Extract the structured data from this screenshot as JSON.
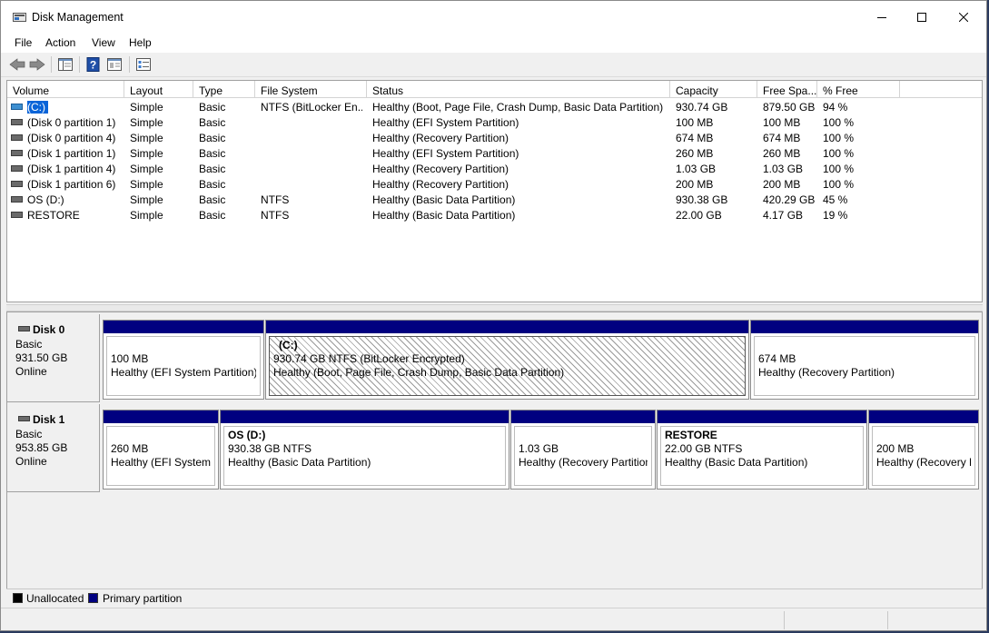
{
  "window": {
    "title": "Disk Management",
    "controls": {
      "minimize": "minimize",
      "maximize": "maximize",
      "close": "close"
    }
  },
  "menubar": {
    "items": [
      "File",
      "Action",
      "View",
      "Help"
    ]
  },
  "toolbar": {
    "buttons": [
      "back-icon",
      "forward-icon",
      "console-tree-icon",
      "help-icon",
      "properties-icon",
      "settings-icon"
    ]
  },
  "volume_list": {
    "columns": [
      "Volume",
      "Layout",
      "Type",
      "File System",
      "Status",
      "Capacity",
      "Free Spa...",
      "% Free"
    ],
    "rows": [
      {
        "volume": "(C:)",
        "layout": "Simple",
        "type": "Basic",
        "fs": "NTFS (BitLocker En...",
        "status": "Healthy (Boot, Page File, Crash Dump, Basic Data Partition)",
        "capacity": "930.74 GB",
        "free": "879.50 GB",
        "pct": "94 %",
        "selected": true
      },
      {
        "volume": "(Disk 0 partition 1)",
        "layout": "Simple",
        "type": "Basic",
        "fs": "",
        "status": "Healthy (EFI System Partition)",
        "capacity": "100 MB",
        "free": "100 MB",
        "pct": "100 %"
      },
      {
        "volume": "(Disk 0 partition 4)",
        "layout": "Simple",
        "type": "Basic",
        "fs": "",
        "status": "Healthy (Recovery Partition)",
        "capacity": "674 MB",
        "free": "674 MB",
        "pct": "100 %"
      },
      {
        "volume": "(Disk 1 partition 1)",
        "layout": "Simple",
        "type": "Basic",
        "fs": "",
        "status": "Healthy (EFI System Partition)",
        "capacity": "260 MB",
        "free": "260 MB",
        "pct": "100 %"
      },
      {
        "volume": "(Disk 1 partition 4)",
        "layout": "Simple",
        "type": "Basic",
        "fs": "",
        "status": "Healthy (Recovery Partition)",
        "capacity": "1.03 GB",
        "free": "1.03 GB",
        "pct": "100 %"
      },
      {
        "volume": "(Disk 1 partition 6)",
        "layout": "Simple",
        "type": "Basic",
        "fs": "",
        "status": "Healthy (Recovery Partition)",
        "capacity": "200 MB",
        "free": "200 MB",
        "pct": "100 %"
      },
      {
        "volume": "OS (D:)",
        "layout": "Simple",
        "type": "Basic",
        "fs": "NTFS",
        "status": "Healthy (Basic Data Partition)",
        "capacity": "930.38 GB",
        "free": "420.29 GB",
        "pct": "45 %"
      },
      {
        "volume": "RESTORE",
        "layout": "Simple",
        "type": "Basic",
        "fs": "NTFS",
        "status": "Healthy (Basic Data Partition)",
        "capacity": "22.00 GB",
        "free": "4.17 GB",
        "pct": "19 %"
      }
    ]
  },
  "disks": [
    {
      "name": "Disk 0",
      "kind": "Basic",
      "size": "931.50 GB",
      "state": "Online",
      "partitions": [
        {
          "name": "",
          "line1": "100 MB",
          "line2": "Healthy (EFI System Partition)"
        },
        {
          "name": "(C:)",
          "line1": "930.74 GB NTFS (BitLocker Encrypted)",
          "line2": "Healthy (Boot, Page File, Crash Dump, Basic Data Partition)",
          "selected": true
        },
        {
          "name": "",
          "line1": "674 MB",
          "line2": "Healthy (Recovery Partition)"
        }
      ]
    },
    {
      "name": "Disk 1",
      "kind": "Basic",
      "size": "953.85 GB",
      "state": "Online",
      "partitions": [
        {
          "name": "",
          "line1": "260 MB",
          "line2": "Healthy (EFI System P"
        },
        {
          "name": "OS  (D:)",
          "line1": "930.38 GB NTFS",
          "line2": "Healthy (Basic Data Partition)"
        },
        {
          "name": "",
          "line1": "1.03 GB",
          "line2": "Healthy (Recovery Partition)"
        },
        {
          "name": "RESTORE",
          "line1": "22.00 GB NTFS",
          "line2": "Healthy (Basic Data Partition)"
        },
        {
          "name": "",
          "line1": "200 MB",
          "line2": "Healthy (Recovery Pa"
        }
      ]
    }
  ],
  "legend": [
    {
      "label": "Unallocated",
      "color": "#000000"
    },
    {
      "label": "Primary partition",
      "color": "#000080"
    }
  ]
}
